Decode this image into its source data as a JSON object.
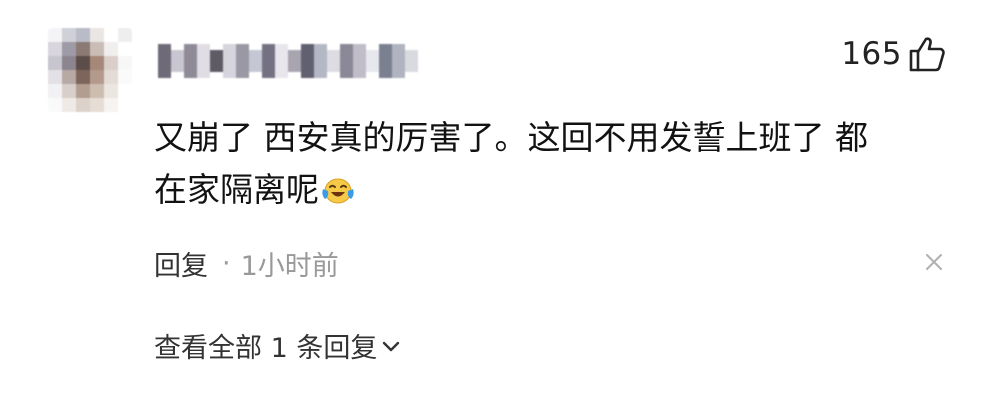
{
  "comment": {
    "username_censored": true,
    "likes": {
      "count": "165",
      "icon": "thumbs-up-icon"
    },
    "text_line1": "又崩了 西安真的厉害了。这回不用发誓上班了 都",
    "text_line2": "在家隔离呢",
    "emoji": "laughing-crying-emoji",
    "reply_label": "回复",
    "separator": "·",
    "time": "1小时前",
    "close_icon": "close-icon",
    "view_all_label": "查看全部 1 条回复",
    "view_all_icon": "chevron-down-icon"
  },
  "colors": {
    "text": "#111111",
    "muted": "#999999",
    "background": "#ffffff"
  }
}
